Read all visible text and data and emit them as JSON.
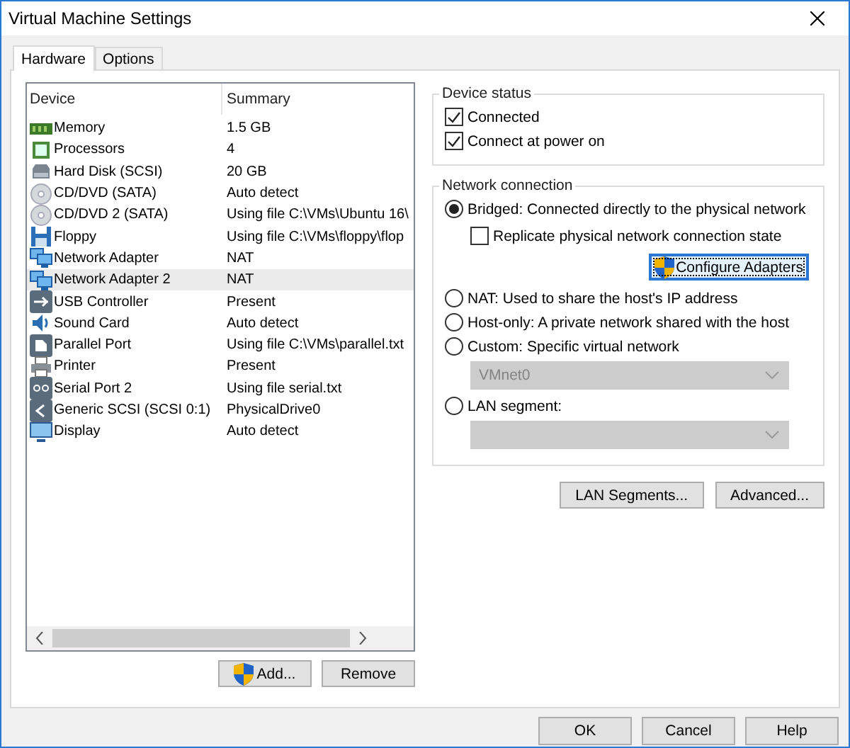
{
  "window": {
    "title": "Virtual Machine Settings"
  },
  "tabs": [
    {
      "label": "Hardware",
      "selected": true
    },
    {
      "label": "Options",
      "selected": false
    }
  ],
  "device_list": {
    "columns": [
      "Device",
      "Summary"
    ],
    "rows": [
      {
        "kind": "memory",
        "device": "Memory",
        "summary": "1.5 GB",
        "selected": false
      },
      {
        "kind": "cpu",
        "device": "Processors",
        "summary": "4",
        "selected": false
      },
      {
        "kind": "disk",
        "device": "Hard Disk (SCSI)",
        "summary": "20 GB",
        "selected": false
      },
      {
        "kind": "cd",
        "device": "CD/DVD (SATA)",
        "summary": "Auto detect",
        "selected": false
      },
      {
        "kind": "cd",
        "device": "CD/DVD 2 (SATA)",
        "summary": "Using file C:\\VMs\\Ubuntu 16\\",
        "selected": false
      },
      {
        "kind": "floppy",
        "device": "Floppy",
        "summary": "Using file C:\\VMs\\floppy\\flop",
        "selected": false
      },
      {
        "kind": "network",
        "device": "Network Adapter",
        "summary": "NAT",
        "selected": false
      },
      {
        "kind": "network",
        "device": "Network Adapter 2",
        "summary": "NAT",
        "selected": true
      },
      {
        "kind": "usb",
        "device": "USB Controller",
        "summary": "Present",
        "selected": false
      },
      {
        "kind": "sound",
        "device": "Sound Card",
        "summary": "Auto detect",
        "selected": false
      },
      {
        "kind": "parallel",
        "device": "Parallel Port",
        "summary": "Using file C:\\VMs\\parallel.txt",
        "selected": false
      },
      {
        "kind": "printer",
        "device": "Printer",
        "summary": "Present",
        "selected": false
      },
      {
        "kind": "serial",
        "device": "Serial Port 2",
        "summary": "Using file serial.txt",
        "selected": false
      },
      {
        "kind": "scsi",
        "device": "Generic SCSI (SCSI 0:1)",
        "summary": "PhysicalDrive0",
        "selected": false
      },
      {
        "kind": "display",
        "device": "Display",
        "summary": "Auto detect",
        "selected": false
      }
    ]
  },
  "list_buttons": [
    {
      "kind": "shield",
      "label": "Add..."
    },
    {
      "kind": "plain",
      "label": "Remove"
    }
  ],
  "device_status": {
    "title": "Device status",
    "options": [
      {
        "label": "Connected",
        "checked": true
      },
      {
        "label": "Connect at power on",
        "checked": true
      }
    ]
  },
  "network_connection": {
    "title": "Network connection",
    "options": [
      {
        "kind": "radio",
        "label": "Bridged: Connected directly to the physical network",
        "selected": true
      },
      {
        "kind": "checkbox",
        "label": "Replicate physical network connection state",
        "checked": false
      },
      {
        "kind": "button",
        "label": "Configure Adapters",
        "focused": true
      },
      {
        "kind": "radio",
        "label": "NAT: Used to share the host's IP address",
        "selected": false
      },
      {
        "kind": "radio",
        "label": "Host-only: A private network shared with the host",
        "selected": false
      },
      {
        "kind": "radio",
        "label": "Custom: Specific virtual network",
        "selected": false
      },
      {
        "kind": "dropdown",
        "value": "VMnet0",
        "disabled": true
      },
      {
        "kind": "radio",
        "label": "LAN segment:",
        "selected": false
      },
      {
        "kind": "dropdown",
        "disabled": true
      }
    ]
  },
  "network_buttons": [
    "LAN Segments...",
    "Advanced..."
  ],
  "footer_buttons": [
    "OK",
    "Cancel",
    "Help"
  ]
}
